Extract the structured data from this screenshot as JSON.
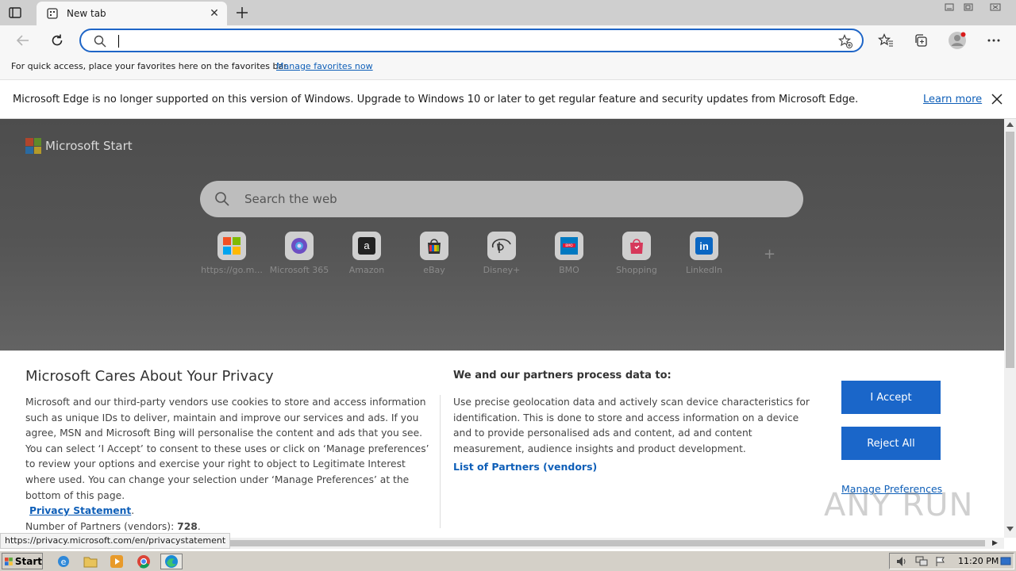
{
  "browser": {
    "tab": {
      "title": "New tab"
    },
    "address_bar": {
      "value": ""
    },
    "favorites_bar": {
      "message": "For quick access, place your favorites here on the favorites bar.",
      "link": "Manage favorites now"
    },
    "info_bar": {
      "message": "Microsoft Edge is no longer supported on this version of Windows. Upgrade to Windows 10 or later to get regular feature and security updates from Microsoft Edge.",
      "link": "Learn more"
    }
  },
  "page": {
    "brand": "Microsoft Start",
    "search_placeholder": "Search the web",
    "quick_links": [
      {
        "label": "https://go.m...",
        "icon": "microsoft-icon"
      },
      {
        "label": "Microsoft 365",
        "icon": "microsoft365-icon"
      },
      {
        "label": "Amazon",
        "icon": "amazon-icon"
      },
      {
        "label": "eBay",
        "icon": "ebay-icon"
      },
      {
        "label": "Disney+",
        "icon": "disney-icon"
      },
      {
        "label": "BMO",
        "icon": "bmo-icon"
      },
      {
        "label": "Shopping",
        "icon": "shopping-icon"
      },
      {
        "label": "LinkedIn",
        "icon": "linkedin-icon"
      }
    ],
    "add_shortcut": "+"
  },
  "privacy": {
    "title": "Microsoft Cares About Your Privacy",
    "body": "Microsoft and our third-party vendors use cookies to store and access information such as unique IDs to deliver, maintain and improve our services and ads. If you agree, MSN and Microsoft Bing will personalise the content and ads that you see. You can select ‘I Accept’ to consent to these uses or click on ‘Manage preferences’ to review your options and exercise your right to object to Legitimate Interest where used.  You can change your selection under ‘Manage Preferences’ at the bottom of this page.",
    "privacy_statement": "Privacy Statement",
    "partners_count_label": "Number of Partners (vendors): ",
    "partners_count": "728",
    "purpose_heading": "We and our partners process data to:",
    "purpose_text": "Use precise geolocation data and actively scan device characteristics for identification. This is done to store and access information on a device and to provide personalised ads and content, ad and content measurement, audience insights and product development.",
    "partners_link": "List of Partners (vendors)",
    "accept": "I Accept",
    "reject": "Reject All",
    "manage": "Manage Preferences"
  },
  "status_url": "https://privacy.microsoft.com/en/privacystatement",
  "watermark": "ANY RUN",
  "taskbar": {
    "start": "Start",
    "clock": "11:20 PM"
  },
  "colors": {
    "accent": "#1a66c9",
    "link": "#0f5fb8"
  }
}
